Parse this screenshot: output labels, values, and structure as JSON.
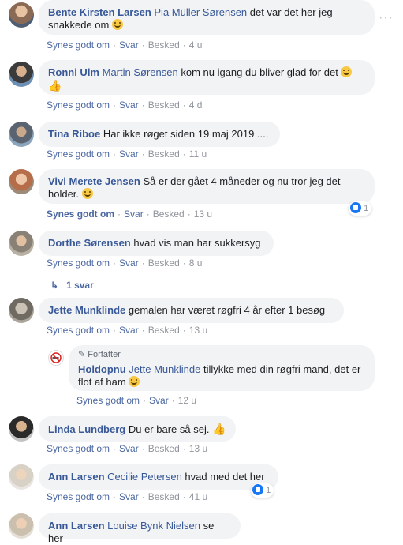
{
  "comments": [
    {
      "name": "Bente Kirsten Larsen",
      "tag": "Pia Müller Sørensen",
      "text": "det var det her jeg snakkede om",
      "emoji": "grin-emoji",
      "like": "Synes godt om",
      "reply": "Svar",
      "message": "Besked",
      "time": "4 u"
    },
    {
      "name": "Ronni Ulm",
      "tag": "Martin Sørensen",
      "text": "kom nu igang du bliver glad for det",
      "emoji": "laugh-emoji",
      "like": "Synes godt om",
      "reply": "Svar",
      "message": "Besked",
      "time": "4 d"
    },
    {
      "name": "Tina Riboe",
      "text": "Har ikke røget siden 19 maj 2019 ....",
      "like": "Synes godt om",
      "reply": "Svar",
      "message": "Besked",
      "time": "11 u"
    },
    {
      "name": "Vivi Merete Jensen",
      "text": "Så er der gået 4 måneder og nu tror jeg det holder.",
      "like": "Synes godt om",
      "reply": "Svar",
      "message": "Besked",
      "time": "13 u",
      "reactions": "1"
    },
    {
      "name": "Dorthe Sørensen",
      "text": "hvad vis man har sukkersyg",
      "like": "Synes godt om",
      "reply": "Svar",
      "message": "Besked",
      "time": "8 u",
      "replies_label": "1 svar"
    },
    {
      "name": "Jette Munklinde",
      "text": "gemalen har været røgfri 4 år efter 1 besøg",
      "like": "Synes godt om",
      "reply": "Svar",
      "message": "Besked",
      "time": "13 u"
    },
    {
      "author_badge": "Forfatter",
      "name": "Holdopnu",
      "tag": "Jette Munklinde",
      "text": "tillykke med din røgfri mand, det er flot af ham",
      "like": "Synes godt om",
      "reply": "Svar",
      "time": "12 u"
    },
    {
      "name": "Linda Lundberg",
      "text": "Du er bare så sej.",
      "like": "Synes godt om",
      "reply": "Svar",
      "message": "Besked",
      "time": "13 u"
    },
    {
      "name": "Ann Larsen",
      "tag": "Cecilie Petersen",
      "text": "hvad med det her",
      "like": "Synes godt om",
      "reply": "Svar",
      "message": "Besked",
      "time": "41 u",
      "reactions": "1"
    },
    {
      "name": "Ann Larsen",
      "tag": "Louise Bynk Nielsen",
      "text": "se her"
    }
  ],
  "more_icon": "more-options-icon",
  "colors": {
    "link": "#385898",
    "bubble": "#f2f3f5",
    "meta": "#90949c",
    "like_blue": "#1877f2"
  }
}
